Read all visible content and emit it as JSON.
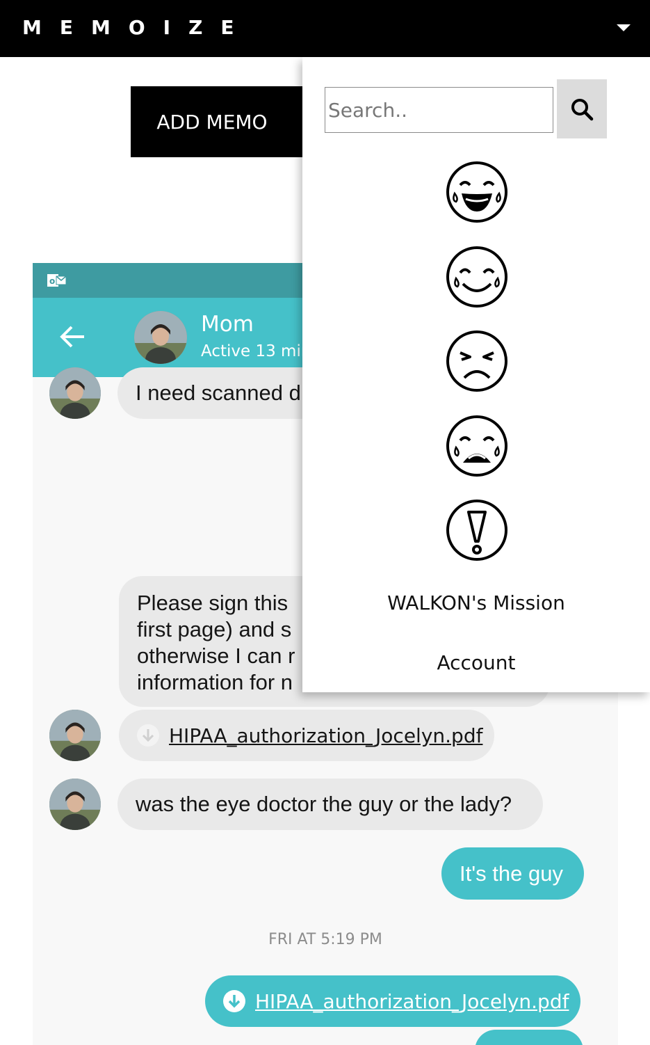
{
  "header": {
    "brand": "MEMOIZE"
  },
  "toolbar": {
    "add_memo_label": "ADD MEMO"
  },
  "dropdown": {
    "search_placeholder": "Search..",
    "emojis": [
      "laughing-tears-emoji",
      "smiling-tears-emoji",
      "angry-emoji",
      "crying-emoji",
      "alarmed-emoji"
    ],
    "links": [
      "WALKON's Mission",
      "Account"
    ]
  },
  "chat": {
    "contact_name": "Mom",
    "contact_status": "Active 13 mir",
    "messages": {
      "m1": "I need scanned d",
      "m2_lines": [
        "Please sign this",
        "first page) and s",
        "otherwise I can r",
        "information for n"
      ],
      "m3_file": "HIPAA_authorization_Jocelyn.pdf",
      "m4": "was the eye doctor the guy or the lady?",
      "m5": "It's the guy",
      "timestamp": "FRI AT 5:19 PM",
      "m6_file": "HIPAA_authorization_Jocelyn.pdf"
    }
  },
  "colors": {
    "accent": "#45c1c9",
    "status_bar": "#3e9ba1",
    "bubble_in": "#e9e9e9",
    "topbar": "#000000"
  }
}
